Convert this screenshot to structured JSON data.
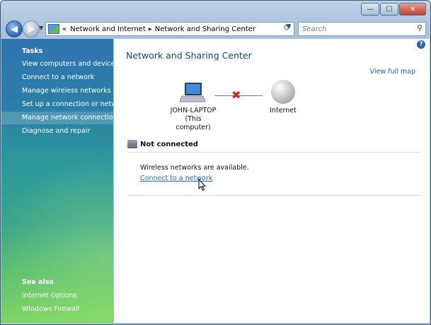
{
  "window": {
    "controls": {
      "minimize": "—",
      "maximize": "☐",
      "close": "✕"
    }
  },
  "address_bar": {
    "prefix": "«",
    "crumbs": [
      "Network and Internet",
      "Network and Sharing Center"
    ],
    "separator": "▸",
    "search_placeholder": "Search"
  },
  "sidebar": {
    "tasks_title": "Tasks",
    "tasks": [
      "View computers and devices",
      "Connect to a network",
      "Manage wireless networks",
      "Set up a connection or network",
      "Manage network connections",
      "Diagnose and repair"
    ],
    "see_also_title": "See also",
    "see_also": [
      "Internet Options",
      "Windows Firewall"
    ]
  },
  "main": {
    "title": "Network and Sharing Center",
    "view_full_map": "View full map",
    "computer_name": "JOHN-LAPTOP",
    "computer_sub": "(This computer)",
    "internet_label": "Internet",
    "status": "Not connected",
    "wireless_message": "Wireless networks are available.",
    "connect_link": "Connect to a network"
  },
  "icons": {
    "back": "back-arrow-icon",
    "forward": "forward-arrow-icon",
    "refresh": "refresh-icon",
    "search": "search-icon",
    "help": "help-icon",
    "laptop": "laptop-icon",
    "globe": "internet-globe-icon",
    "disconnected": "red-x-icon"
  },
  "colors": {
    "title_blue": "#1b3e8a",
    "link_blue": "#2a6acb",
    "error_red": "#d8261a"
  }
}
